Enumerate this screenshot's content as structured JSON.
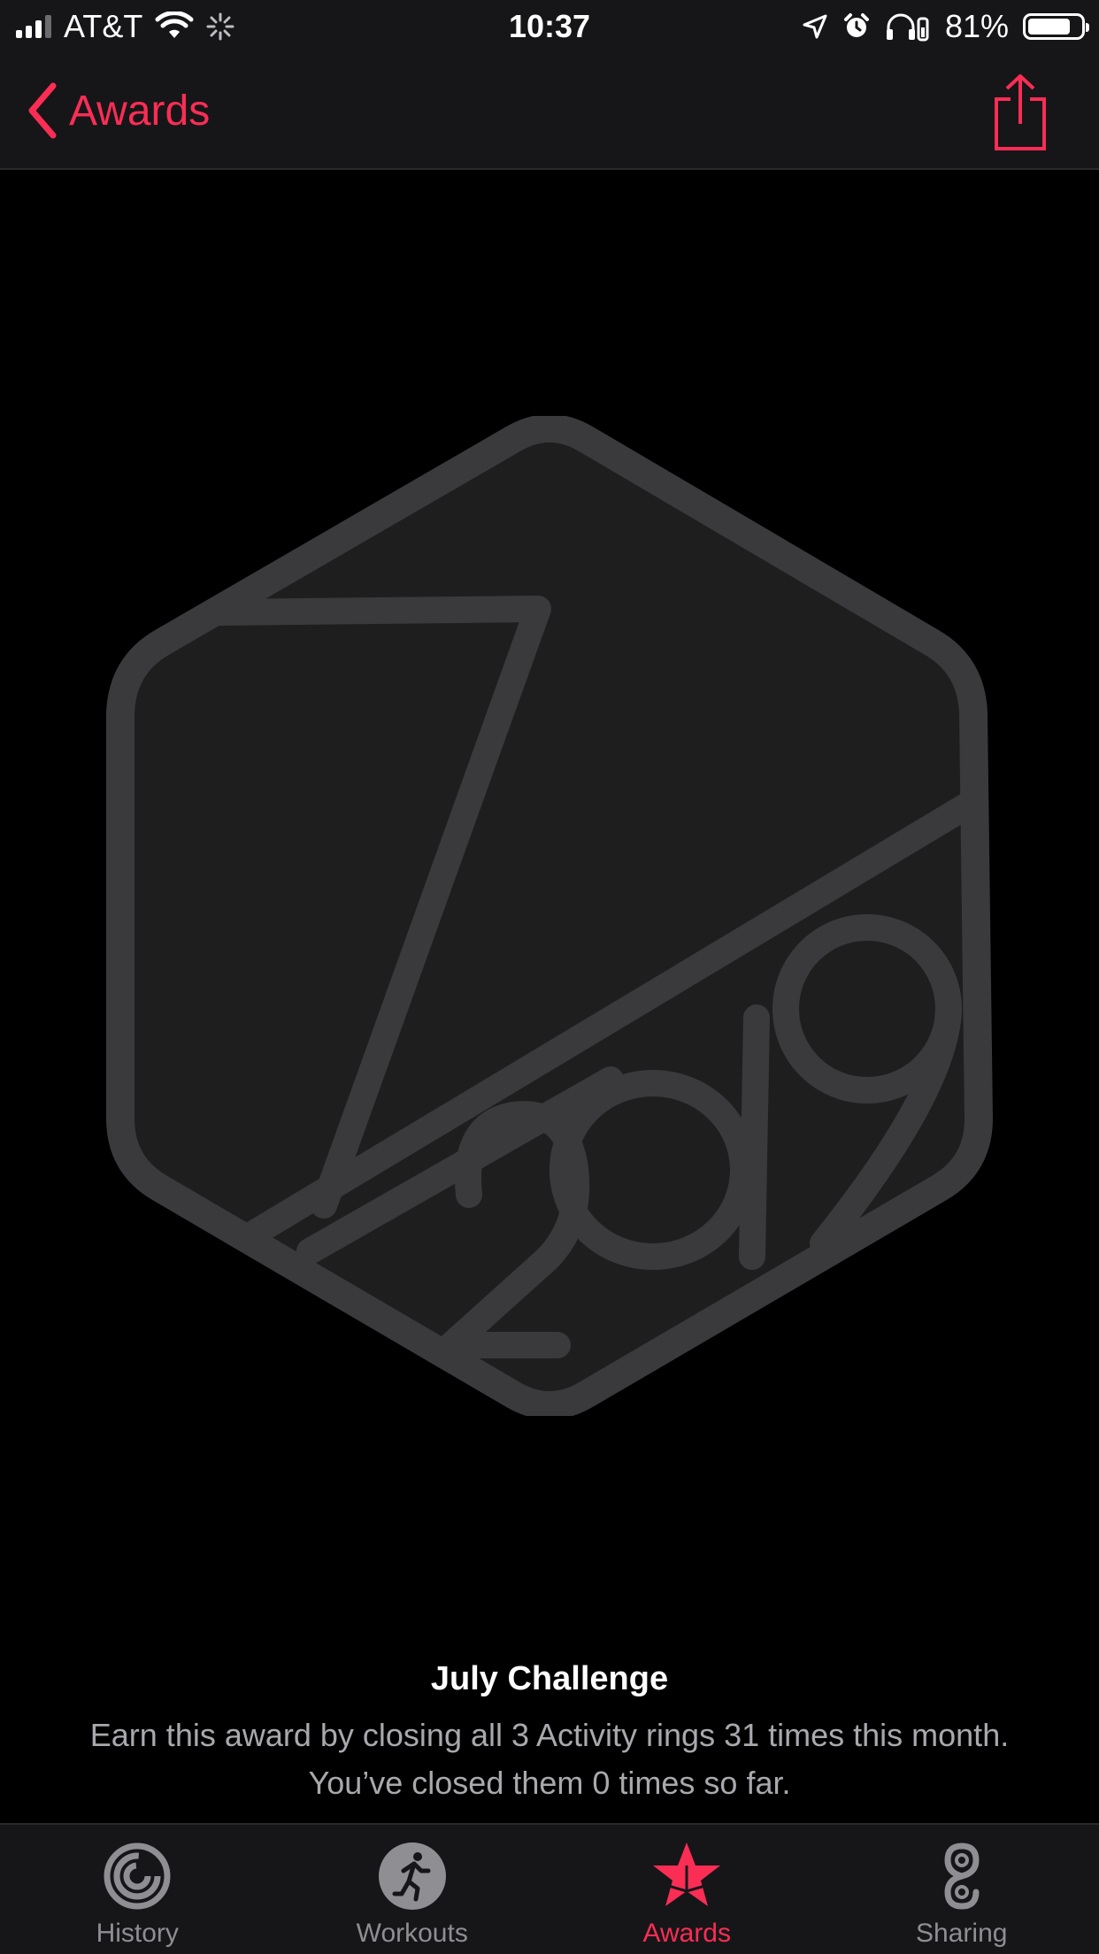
{
  "status_bar": {
    "carrier": "AT&T",
    "time": "10:37",
    "battery_percent": "81%",
    "battery_level": 0.81,
    "icons": [
      "signal-icon",
      "wifi-icon",
      "activity-spinner-icon",
      "location-arrow-icon",
      "alarm-icon",
      "headphones-icon",
      "battery-icon"
    ]
  },
  "nav": {
    "back_label": "Awards",
    "share_icon": "share-icon"
  },
  "award": {
    "title": "July Challenge",
    "description": "Earn this award by closing all 3 Activity rings 31 times this month. You’ve closed them 0 times so far."
  },
  "tabs": [
    {
      "label": "History",
      "icon": "history-rings-icon",
      "active": false
    },
    {
      "label": "Workouts",
      "icon": "running-figure-icon",
      "active": false
    },
    {
      "label": "Awards",
      "icon": "star-award-icon",
      "active": true
    },
    {
      "label": "Sharing",
      "icon": "sharing-rings-icon",
      "active": false
    }
  ],
  "colors": {
    "accent": "#fa2d55",
    "badge_stroke": "#3a3a3c",
    "badge_fill": "#1e1e1f",
    "bar_bg": "#161618",
    "inactive_tab": "#8e8e93"
  }
}
